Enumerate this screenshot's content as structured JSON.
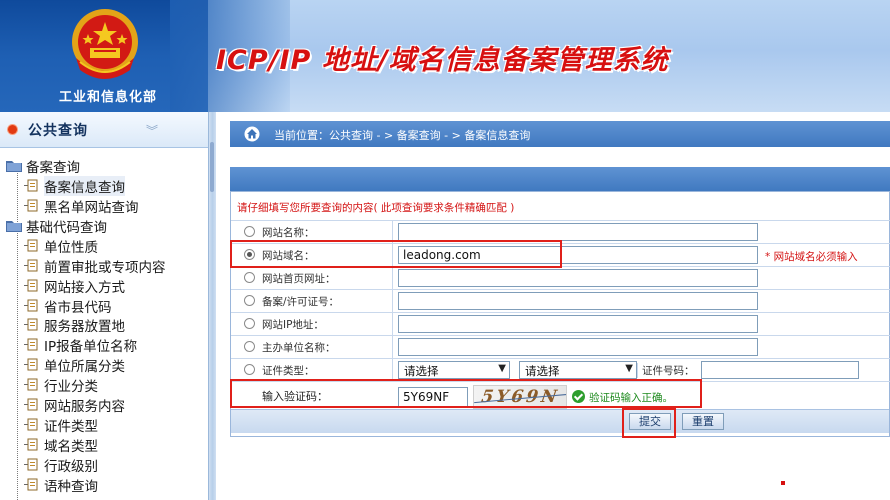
{
  "header": {
    "ministry": "工业和信息化部",
    "system_title": "ICP/IP 地址/域名信息备案管理系统"
  },
  "sidebar": {
    "title": "公共查询",
    "groups": [
      {
        "label": "备案查询",
        "items": [
          "备案信息查询",
          "黑名单网站查询"
        ]
      },
      {
        "label": "基础代码查询",
        "items": [
          "单位性质",
          "前置审批或专项内容",
          "网站接入方式",
          "省市县代码",
          "服务器放置地",
          "IP报备单位名称",
          "单位所属分类",
          "行业分类",
          "网站服务内容",
          "证件类型",
          "域名类型",
          "行政级别",
          "语种查询"
        ]
      }
    ]
  },
  "breadcrumb": {
    "text": "当前位置：公共查询 - > 备案查询 - > 备案信息查询"
  },
  "form": {
    "instruction": "请仔细填写您所要查询的内容( 此项查询要求条件精确匹配 )",
    "fields": [
      {
        "label": "网站名称：",
        "value": "",
        "checked": false
      },
      {
        "label": "网站域名：",
        "value": "leadong.com",
        "checked": true
      },
      {
        "label": "网站首页网址：",
        "value": "",
        "checked": false
      },
      {
        "label": "备案/许可证号：",
        "value": "",
        "checked": false
      },
      {
        "label": "网站IP地址：",
        "value": "",
        "checked": false
      },
      {
        "label": "主办单位名称：",
        "value": "",
        "checked": false
      }
    ],
    "required_note": "* 网站域名必须输入",
    "cert_row": {
      "label": "证件类型：",
      "select1": "请选择",
      "select2": "请选择",
      "cert_no_label": "证件号码："
    },
    "captcha": {
      "label": "输入验证码：",
      "value": "5Y69NF",
      "image_text": "5Y69N F",
      "status": "验证码输入正确。"
    },
    "submit_label": "提交",
    "reset_label": "重置"
  },
  "colors": {
    "title_red": "#d71010",
    "header_blue": "#1e5fb3",
    "bar_blue": "#4a82c8",
    "highlight_red": "#e0201a",
    "ok_green": "#2e9e2e"
  }
}
